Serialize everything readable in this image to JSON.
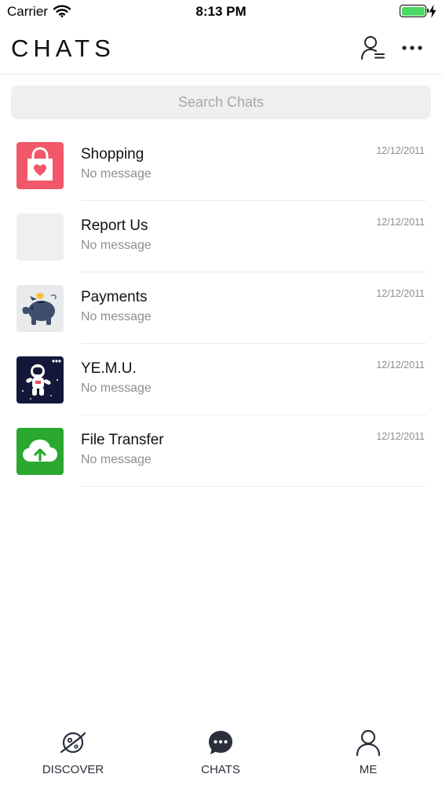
{
  "status_bar": {
    "carrier": "Carrier",
    "time": "8:13 PM",
    "battery_level": 1.0
  },
  "header": {
    "title": "CHATS",
    "contacts_icon": "contacts-list-icon",
    "more_icon": "more-horizontal-icon"
  },
  "search": {
    "placeholder": "Search Chats",
    "value": ""
  },
  "chats": [
    {
      "name": "Shopping",
      "preview": "No message",
      "date": "12/12/2011",
      "avatar_icon": "shopping-bag-heart-icon",
      "avatar_color": "#f2576a"
    },
    {
      "name": "Report Us",
      "preview": "No message",
      "date": "12/12/2011",
      "avatar_icon": "blank-avatar",
      "avatar_color": "#efeff1"
    },
    {
      "name": "Payments",
      "preview": "No message",
      "date": "12/12/2011",
      "avatar_icon": "piggy-bank-icon",
      "avatar_color": "#e9eaec"
    },
    {
      "name": "YE.M.U.",
      "preview": "No message",
      "date": "12/12/2011",
      "avatar_icon": "astronaut-icon",
      "avatar_color": "#13183a"
    },
    {
      "name": "File Transfer",
      "preview": "No message",
      "date": "12/12/2011",
      "avatar_icon": "cloud-upload-icon",
      "avatar_color": "#2aa82f"
    }
  ],
  "tabs": [
    {
      "label": "DISCOVER",
      "icon": "planet-icon"
    },
    {
      "label": "CHATS",
      "icon": "chat-bubble-icon",
      "active": true
    },
    {
      "label": "ME",
      "icon": "person-icon"
    }
  ]
}
